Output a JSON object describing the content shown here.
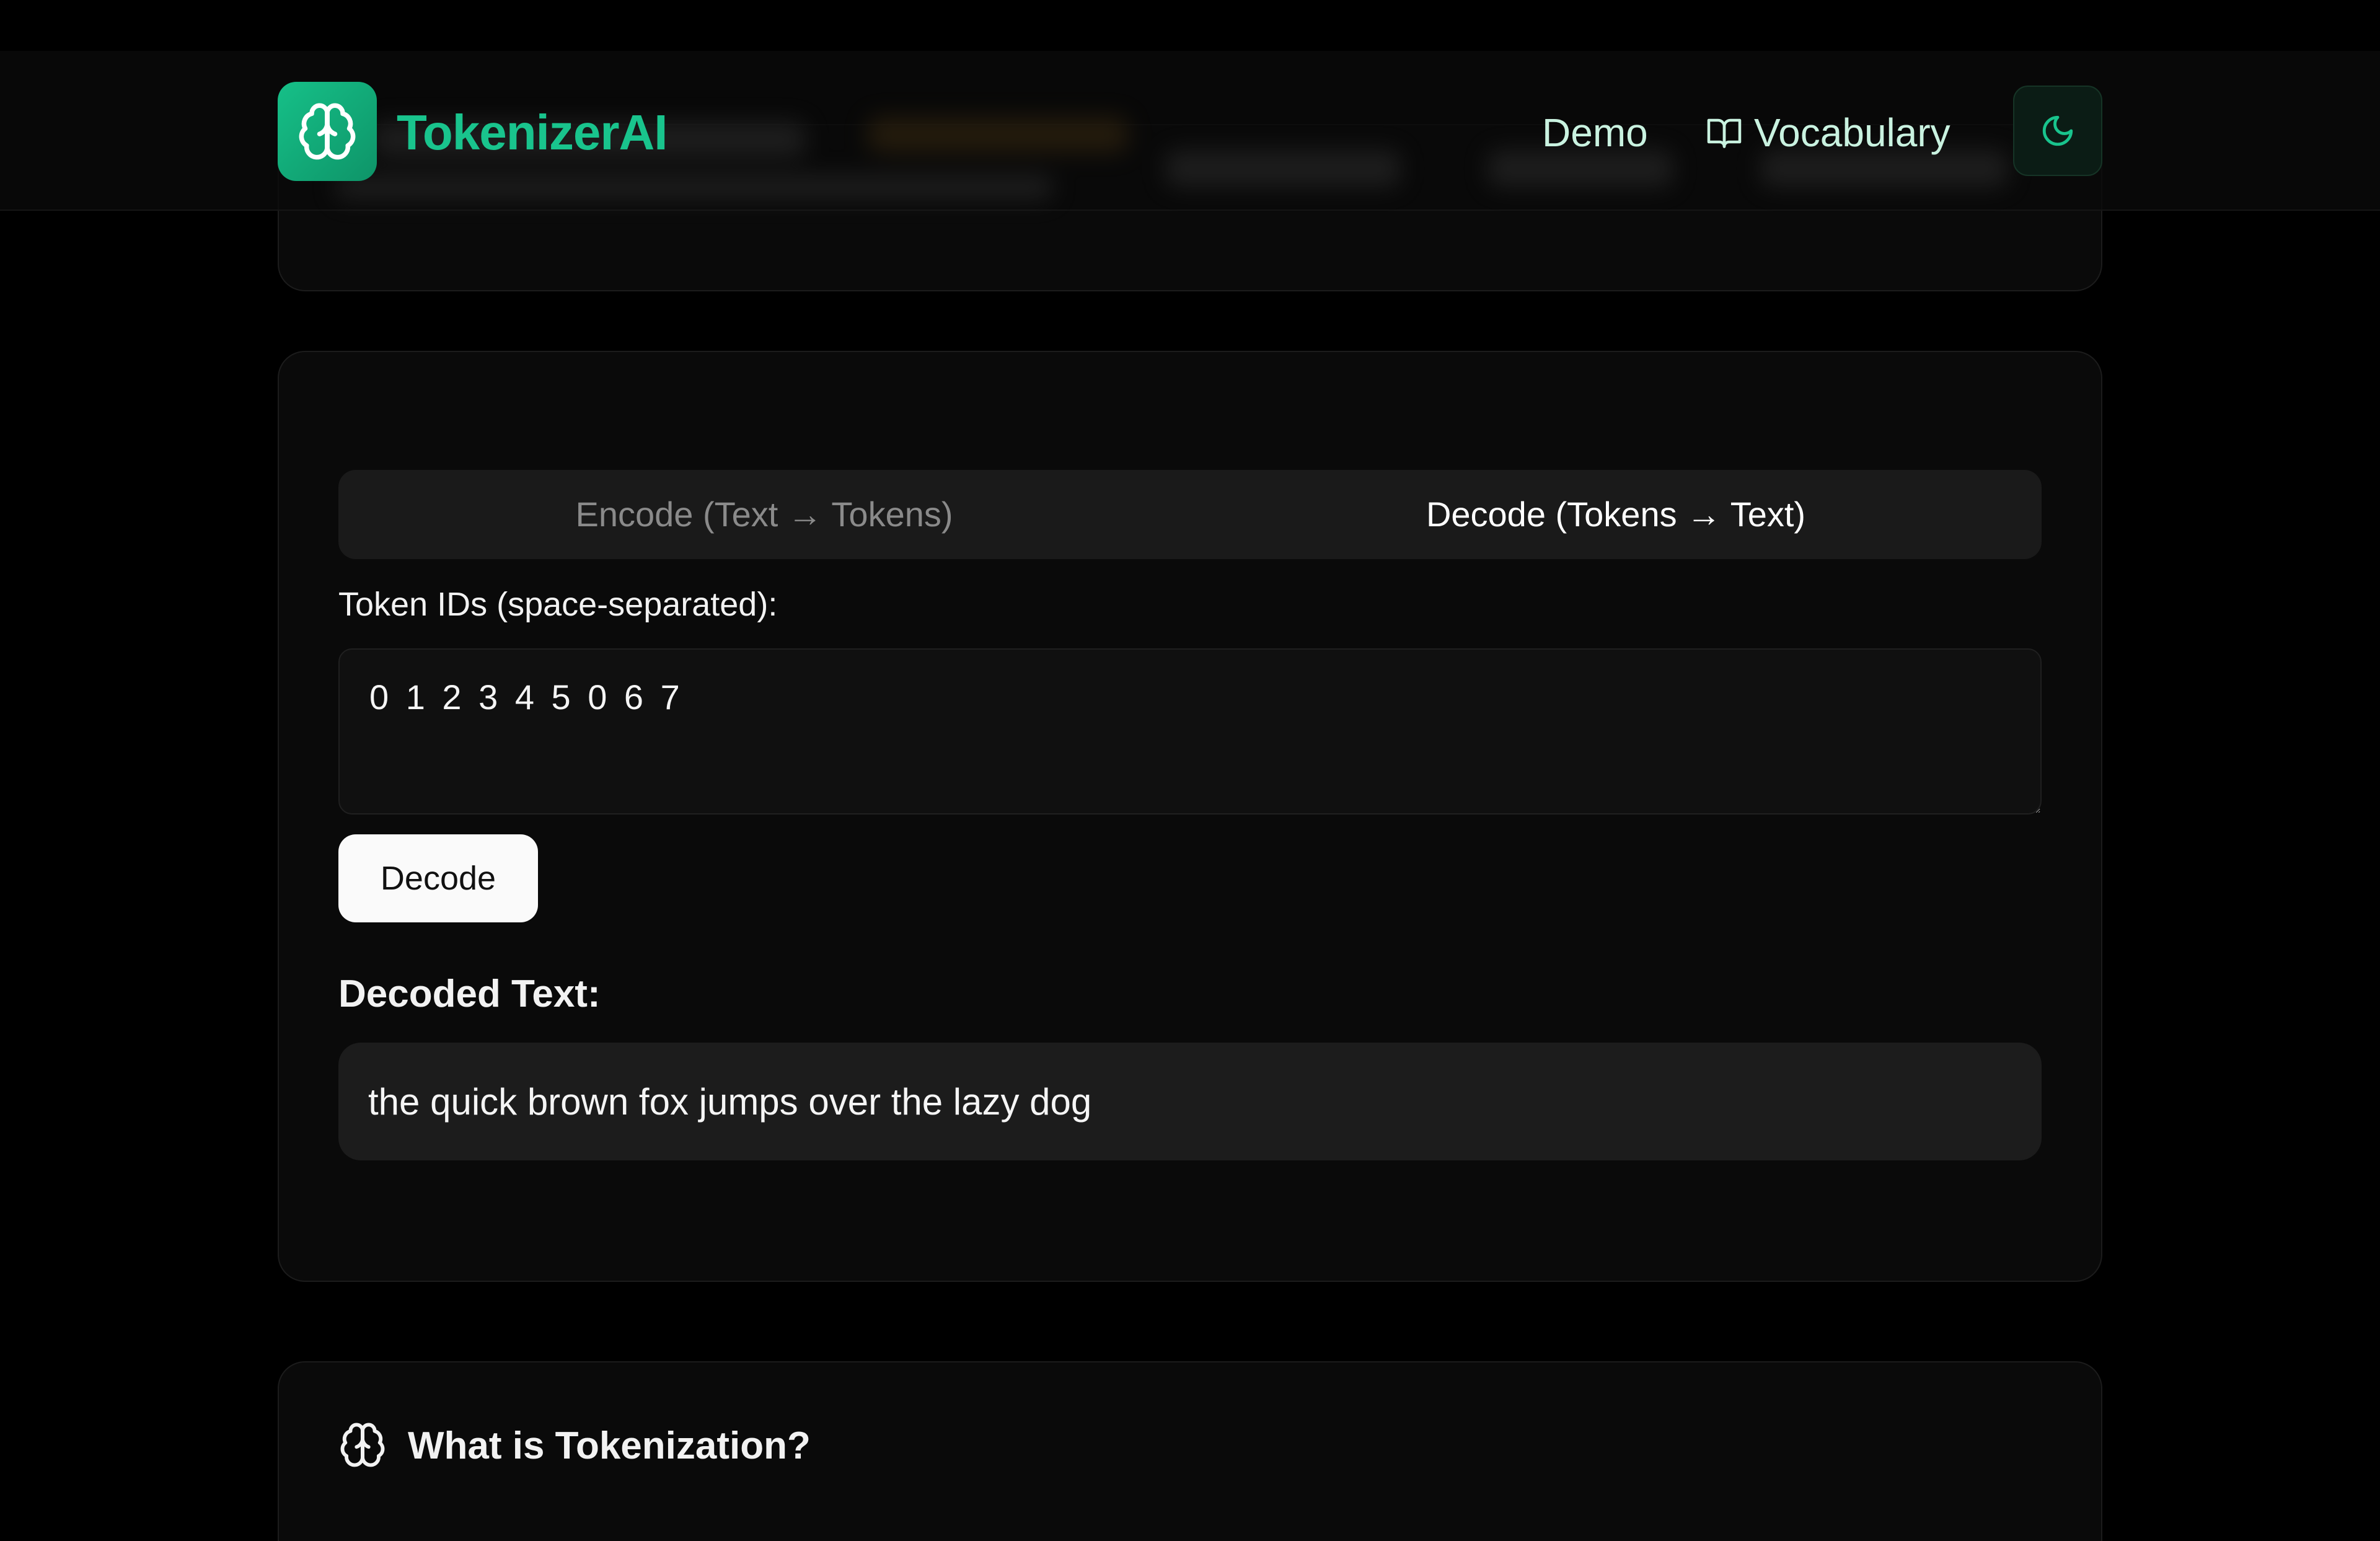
{
  "header": {
    "brand": "TokenizerAI",
    "nav": {
      "demo": "Demo",
      "vocabulary": "Vocabulary"
    },
    "icons": {
      "logo": "brain-icon",
      "vocabulary": "book-open-icon",
      "theme": "moon-icon"
    }
  },
  "tabs": {
    "encode": "Encode (Text → Tokens)",
    "decode": "Decode (Tokens → Text)",
    "active": "decode"
  },
  "decoder": {
    "input_label": "Token IDs (space-separated):",
    "input_value": "0 1 2 3 4 5 0 6 7",
    "button_label": "Decode",
    "result_heading": "Decoded Text:",
    "result_text": "the quick brown fox jumps over the lazy dog"
  },
  "info": {
    "heading": "What is Tokenization?",
    "icon": "brain-icon"
  },
  "colors": {
    "accent": "#19c48d",
    "nav_text": "#c9f2e0",
    "background": "#000000",
    "card": "#0a0a0a"
  }
}
